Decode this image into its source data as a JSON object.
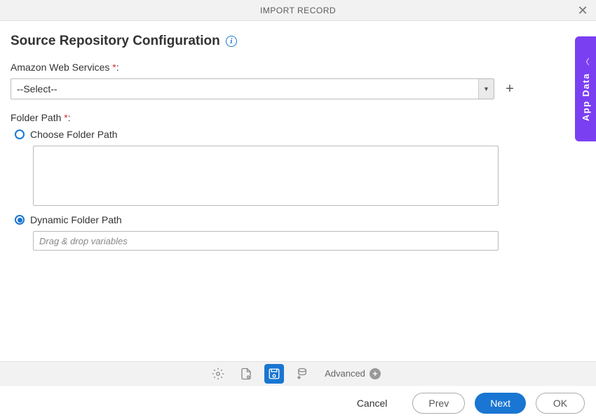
{
  "header": {
    "title": "IMPORT RECORD"
  },
  "section": {
    "title": "Source Repository Configuration"
  },
  "fields": {
    "aws": {
      "label": "Amazon Web Services",
      "selected": "--Select--"
    },
    "folder_path": {
      "label": "Folder Path",
      "options": {
        "choose": "Choose Folder Path",
        "dynamic": "Dynamic Folder Path"
      },
      "dynamic_placeholder": "Drag & drop variables"
    }
  },
  "side_tab": {
    "label": "App Data"
  },
  "toolbar": {
    "advanced": "Advanced"
  },
  "footer": {
    "cancel": "Cancel",
    "prev": "Prev",
    "next": "Next",
    "ok": "OK"
  }
}
